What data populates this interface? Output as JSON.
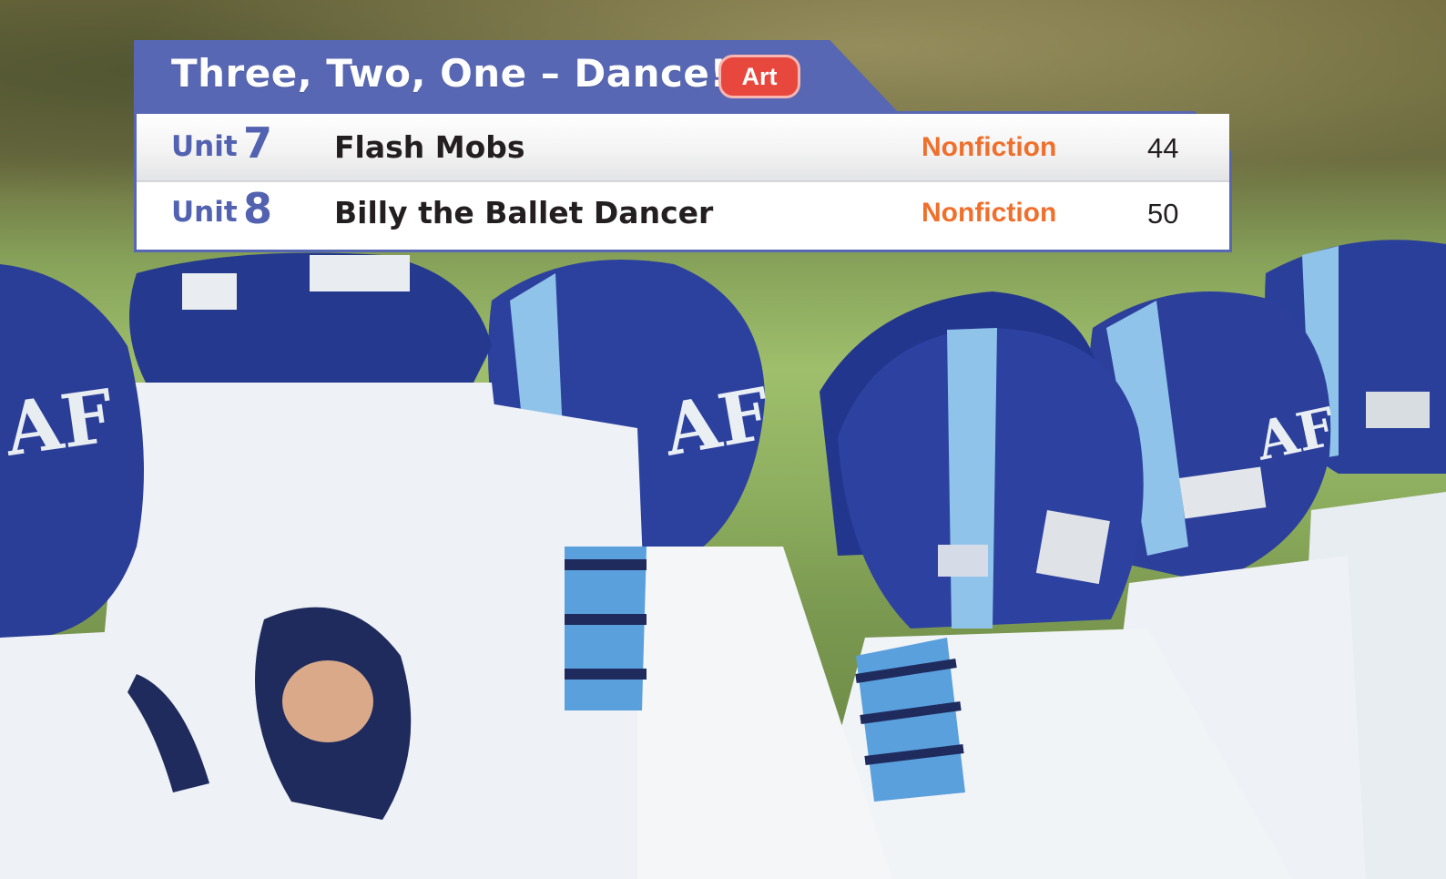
{
  "toc": {
    "title": "Three, Two, One – Dance!",
    "subject_badge": "Art",
    "entries": [
      {
        "unit_label": "Unit",
        "unit_number": "7",
        "title": "Flash Mobs",
        "genre": "Nonfiction",
        "page": "44"
      },
      {
        "unit_label": "Unit",
        "unit_number": "8",
        "title": "Billy the Ballet Dancer",
        "genre": "Nonfiction",
        "page": "50"
      }
    ]
  },
  "photo": {
    "helmet_logo": "AF",
    "colors": {
      "helmet": "#2a3f9a",
      "stripe": "#8fc3ea",
      "jersey": "#eef2f6",
      "grass": "#9fbf6c",
      "panel": "#5867b3",
      "badge": "#e8473e",
      "genre": "#ef6f2c"
    }
  }
}
